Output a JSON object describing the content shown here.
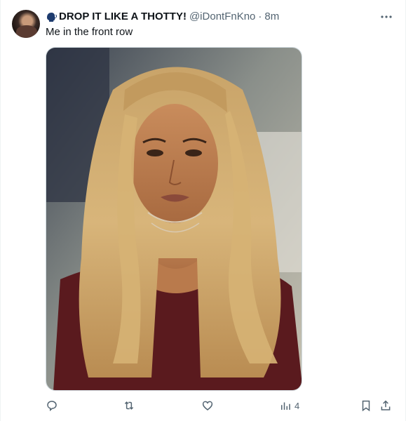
{
  "tweet": {
    "display_name": "DROP IT LIKE A THOTTY!",
    "handle": "@iDontFnKno",
    "separator": "·",
    "time": "8m",
    "text": "Me in the front row",
    "views_count": "4",
    "icons": {
      "name_emoji": "speaking-head-icon",
      "more": "more-horizontal-icon",
      "reply": "reply-icon",
      "retweet": "retweet-icon",
      "like": "like-icon",
      "views": "views-icon",
      "bookmark": "bookmark-icon",
      "share": "share-icon"
    }
  },
  "colors": {
    "text": "#0f1419",
    "secondary": "#536471",
    "border": "#cfd9de"
  }
}
